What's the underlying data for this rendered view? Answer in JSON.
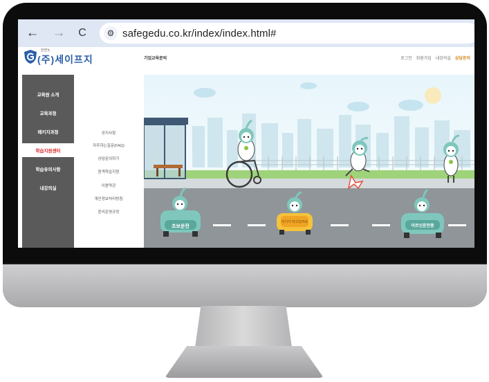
{
  "browser": {
    "back_glyph": "←",
    "forward_glyph": "→",
    "reload_glyph": "C",
    "site_info_glyph": "⚙",
    "url": "safegedu.co.kr/index/index.html#"
  },
  "site": {
    "logo_small": "안전노",
    "logo_text": "(주)세이프지",
    "page_heading": "기업교육문의",
    "top_links": [
      "로그인",
      "회원가입",
      "내강의실",
      "상담문의"
    ],
    "active_top_link_index": 3,
    "accent_color": "#d92a2a",
    "brand_color": "#2c5fa8"
  },
  "sidebar": {
    "items": [
      "교육원 소개",
      "교육과정",
      "패키지과정",
      "학습지원센터",
      "학습유의사항",
      "내강의실"
    ],
    "active_index": 3
  },
  "submenu": {
    "items": [
      "공지사항",
      "자주하는질문(FAQ)",
      "상담문의하기",
      "원격학습지원",
      "이용약관",
      "개인정보처리방침",
      "윤리운영규정"
    ]
  },
  "banner": {
    "car_left_label": "초보운전",
    "car_middle_label": "아기가 타고있어요",
    "car_right_label": "어르신운전중"
  }
}
